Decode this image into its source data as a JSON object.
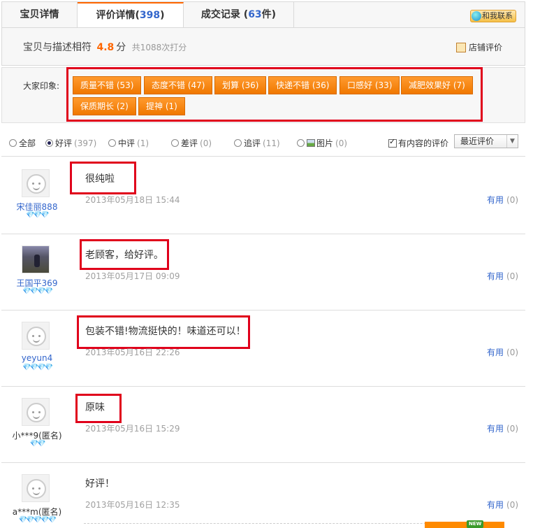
{
  "tabs": [
    {
      "label": "宝贝详情",
      "count": ""
    },
    {
      "label": "评价详情(",
      "count": "398",
      "suffix": ")"
    },
    {
      "label": "成交记录 (",
      "count": "63",
      "suffix": "件)"
    }
  ],
  "contact_button": "和我联系",
  "score": {
    "label": "宝贝与描述相符",
    "value": "4.8",
    "unit": "分",
    "count": "共1088次打分",
    "shop_link": "店铺评价"
  },
  "impressions": {
    "label": "大家印象:",
    "tags": [
      "质量不错 (53)",
      "态度不错 (47)",
      "划算 (36)",
      "快递不错 (36)",
      "口感好 (33)",
      "减肥效果好 (7)",
      "保质期长 (2)",
      "提神 (1)"
    ]
  },
  "filters": {
    "options": [
      {
        "label": "全部",
        "count": ""
      },
      {
        "label": "好评",
        "count": "(397)"
      },
      {
        "label": "中评",
        "count": "(1)"
      },
      {
        "label": "差评",
        "count": "(0)"
      },
      {
        "label": "追评",
        "count": "(11)"
      },
      {
        "label": "图片",
        "count": "(0)"
      }
    ],
    "selected": "好评",
    "with_content_label": "有内容的评价",
    "sort_label": "最近评价"
  },
  "reviews": [
    {
      "user": "宋佳丽888",
      "rank": "💎💎💎",
      "comment": "很纯啦",
      "time": "2013年05月18日 15:44",
      "useful": "有用",
      "useful_count": "(0)"
    },
    {
      "user": "王国平369",
      "rank": "💎💎💎💎",
      "comment": "老顾客，给好评。",
      "time": "2013年05月17日 09:09",
      "useful": "有用",
      "useful_count": "(0)"
    },
    {
      "user": "yeyun4",
      "rank": "💎💎💎💎",
      "comment": "包装不错!物流挺快的！味道还可以！",
      "time": "2013年05月16日 22:26",
      "useful": "有用",
      "useful_count": "(0)"
    },
    {
      "user": "小***9(匿名)",
      "rank": "💎💎",
      "comment": "原味",
      "time": "2013年05月16日 15:29",
      "useful": "有用",
      "useful_count": "(0)"
    },
    {
      "user": "a***m(匿名)",
      "rank": "💎💎💎💎💎",
      "comment": "好评！",
      "time": "2013年05月16日 12:35",
      "useful": "有用",
      "useful_count": "(0)"
    }
  ],
  "badge": "NEW",
  "colors": {
    "accent": "#ff6600",
    "tag": "#f48a10",
    "highlight": "#e0001b",
    "link": "#3366cc"
  }
}
